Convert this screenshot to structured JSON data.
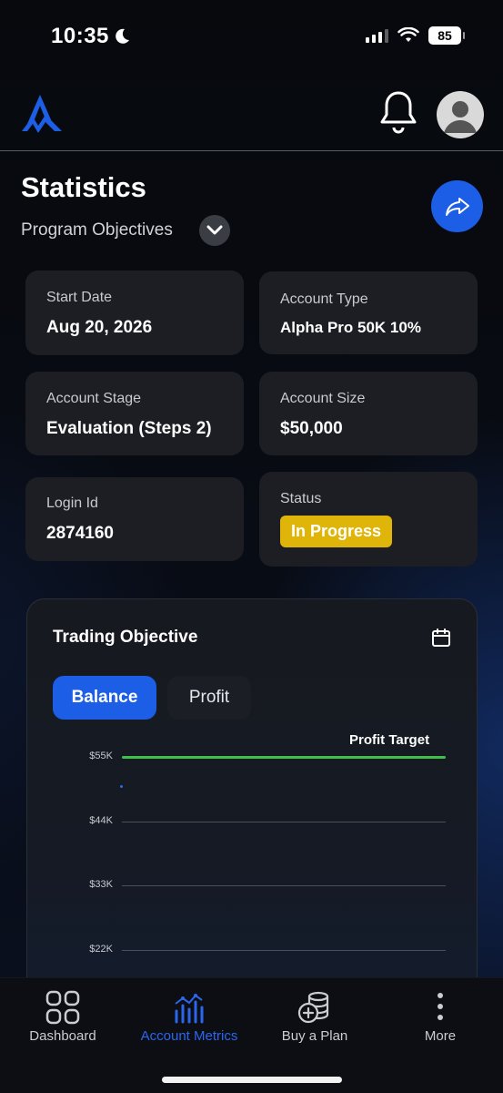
{
  "status_bar": {
    "time": "10:35",
    "battery": "85"
  },
  "header": {
    "logo": "brand-logo",
    "notification_icon": "bell-icon",
    "avatar_icon": "user-icon"
  },
  "page": {
    "title": "Statistics",
    "subtitle": "Program Objectives",
    "share_icon": "share-arrow-icon"
  },
  "info_cards": {
    "start_date": {
      "label": "Start Date",
      "value": "Aug 20, 2026"
    },
    "account_type": {
      "label": "Account Type",
      "value": "Alpha Pro 50K 10%"
    },
    "account_stage": {
      "label": "Account Stage",
      "value": "Evaluation (Steps 2)"
    },
    "account_size": {
      "label": "Account Size",
      "value": "$50,000"
    },
    "login_id": {
      "label": "Login Id",
      "value": "2874160"
    },
    "status": {
      "label": "Status",
      "value": "In Progress",
      "color": "#e0b50a"
    }
  },
  "trading_objective": {
    "title": "Trading Objective",
    "tabs": [
      {
        "label": "Balance",
        "active": true
      },
      {
        "label": "Profit",
        "active": false
      }
    ]
  },
  "chart_data": {
    "type": "line",
    "y_ticks": [
      "$55K",
      "$44K",
      "$33K",
      "$22K"
    ],
    "y_tick_values": [
      55000,
      44000,
      33000,
      22000
    ],
    "series": [
      {
        "values": [
          50000
        ],
        "color": "#2f6bf0"
      }
    ],
    "target_line": {
      "label": "Profit Target",
      "value": 55000,
      "color": "#3fbf4a"
    },
    "grid": true
  },
  "bottom_nav": {
    "items": [
      {
        "label": "Dashboard",
        "icon": "dashboard-grid-icon",
        "active": false
      },
      {
        "label": "Account Metrics",
        "icon": "bar-chart-icon",
        "active": true
      },
      {
        "label": "Buy a Plan",
        "icon": "coins-icon",
        "active": false
      },
      {
        "label": "More",
        "icon": "more-dots-icon",
        "active": false
      }
    ]
  },
  "colors": {
    "accent": "#1d5ee6",
    "card_bg": "#1c1e24",
    "status_badge": "#e0b50a",
    "target_line": "#3fbf4a"
  }
}
